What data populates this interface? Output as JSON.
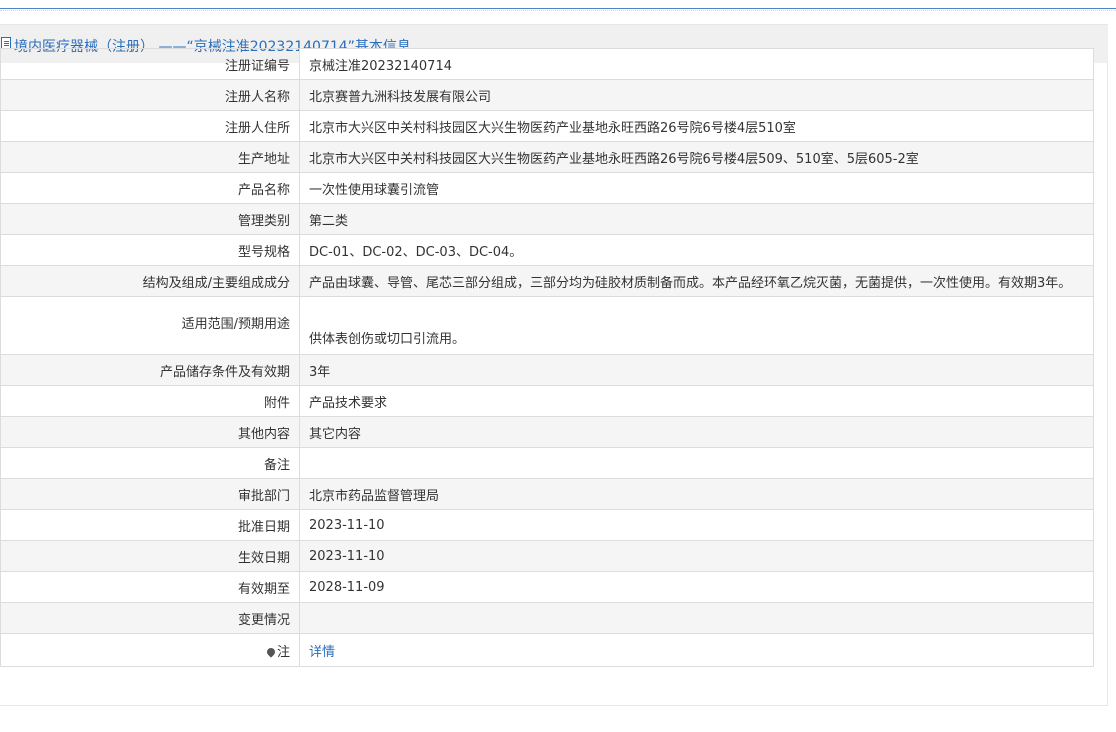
{
  "header": {
    "title": "境内医疗器械（注册） ——“京械注准20232140714”基本信息"
  },
  "rows": [
    {
      "label": "注册证编号",
      "value": "京械注准20232140714"
    },
    {
      "label": "注册人名称",
      "value": "北京赛普九洲科技发展有限公司"
    },
    {
      "label": "注册人住所",
      "value": "北京市大兴区中关村科技园区大兴生物医药产业基地永旺西路26号院6号楼4层510室"
    },
    {
      "label": "生产地址",
      "value": "北京市大兴区中关村科技园区大兴生物医药产业基地永旺西路26号院6号楼4层509、510室、5层605-2室"
    },
    {
      "label": "产品名称",
      "value": "一次性使用球囊引流管"
    },
    {
      "label": "管理类别",
      "value": "第二类"
    },
    {
      "label": "型号规格",
      "value": "DC-01、DC-02、DC-03、DC-04。"
    },
    {
      "label": "结构及组成/主要组成成分",
      "value": "产品由球囊、导管、尾芯三部分组成，三部分均为硅胶材质制备而成。本产品经环氧乙烷灭菌，无菌提供，一次性使用。有效期3年。"
    },
    {
      "label": "适用范围/预期用途",
      "value": "供体表创伤或切口引流用。"
    },
    {
      "label": "产品储存条件及有效期",
      "value": "3年"
    },
    {
      "label": "附件",
      "value": "产品技术要求"
    },
    {
      "label": "其他内容",
      "value": "其它内容"
    },
    {
      "label": "备注",
      "value": ""
    },
    {
      "label": "审批部门",
      "value": "北京市药品监督管理局"
    },
    {
      "label": "批准日期",
      "value": "2023-11-10"
    },
    {
      "label": "生效日期",
      "value": "2023-11-10"
    },
    {
      "label": "有效期至",
      "value": "2028-11-09"
    },
    {
      "label": "变更情况",
      "value": ""
    }
  ],
  "note": {
    "label": "注",
    "link_text": "详情",
    "icon": "pin-icon"
  }
}
